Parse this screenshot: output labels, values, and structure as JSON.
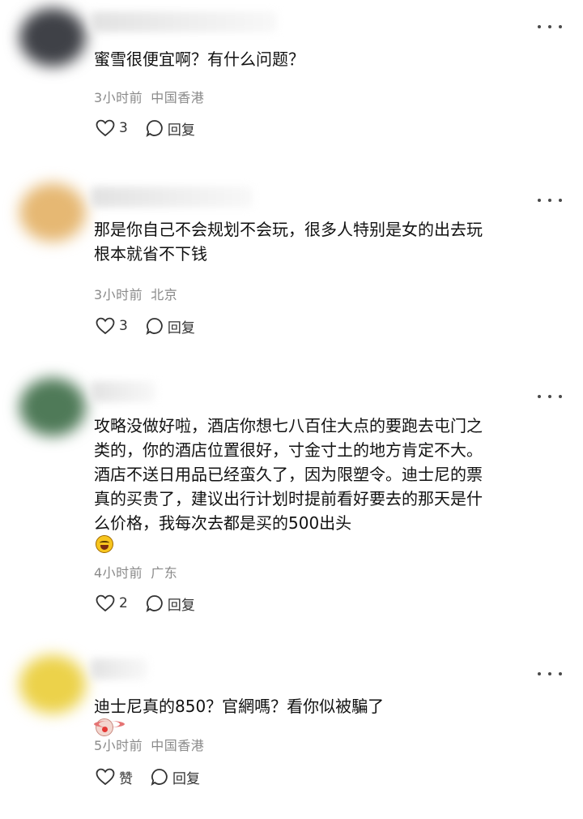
{
  "comments": [
    {
      "avatar_color": "#3f4147",
      "lines": [
        "蜜雪很便宜啊？有什么问题？"
      ],
      "time": "3小时前",
      "location": "中国香港",
      "like_label": "3",
      "reply_label": "回复"
    },
    {
      "avatar_color": "#e6b873",
      "lines": [
        "那是你自己不会规划不会玩，很多人特别是女的出去玩",
        "根本就省不下钱"
      ],
      "time": "3小时前",
      "location": "北京",
      "like_label": "3",
      "reply_label": "回复"
    },
    {
      "avatar_color": "#4f7a58",
      "lines": [
        "攻略没做好啦，酒店你想七八百住大点的要跑去屯门之",
        "类的，你的酒店位置很好，寸金寸土的地方肯定不大。",
        "酒店不送日用品已经蛮久了，因为限塑令。迪士尼的票",
        "真的买贵了，建议出行计划时提前看好要去的那天是什",
        "么价格，我每次去都是买的500出头"
      ],
      "emoji": "rolling-on-floor-laughing-emoji",
      "time": "4小时前",
      "location": "广东",
      "like_label": "2",
      "reply_label": "回复"
    },
    {
      "avatar_color": "#ecd24a",
      "lines": [
        "迪士尼真的850？官網嗎？看你似被騙了"
      ],
      "emoji": "clown-face-emoji",
      "time": "5小时前",
      "location": "中国香港",
      "like_label": "赞",
      "reply_label": "回复"
    }
  ]
}
